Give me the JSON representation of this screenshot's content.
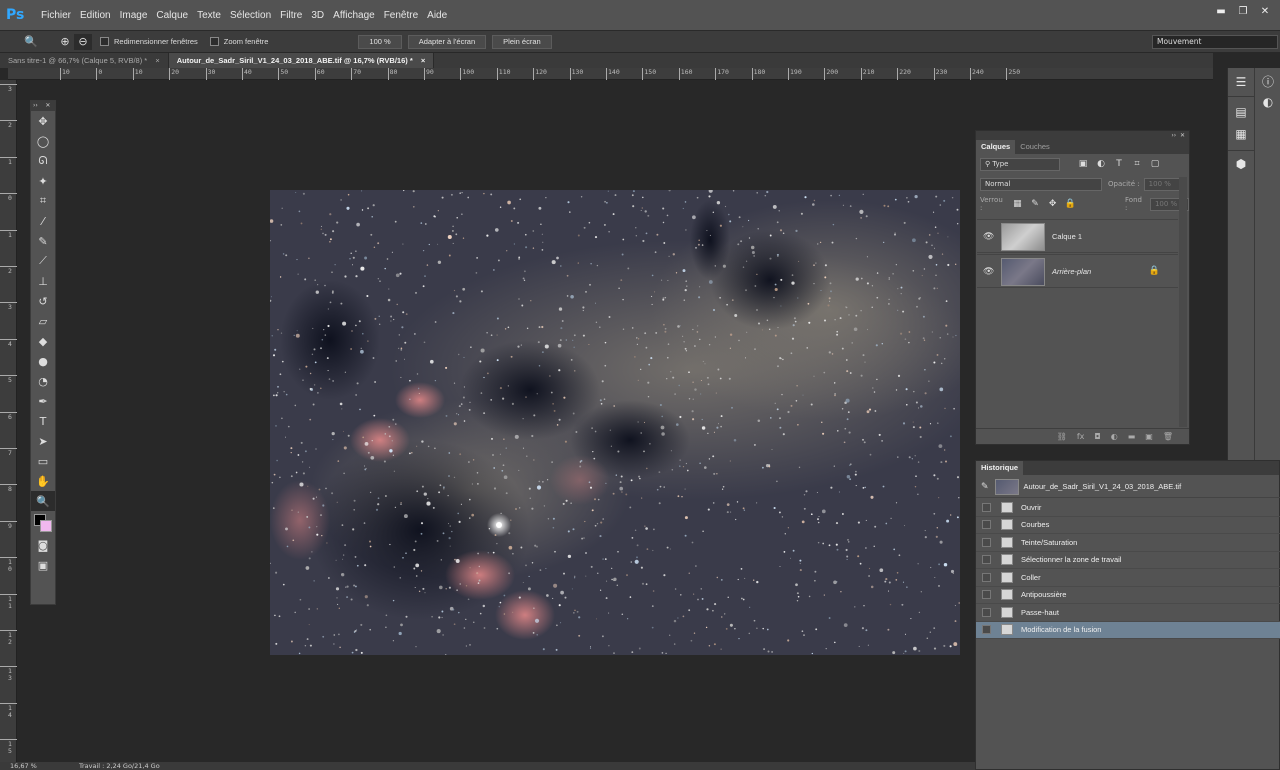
{
  "app": {
    "logo": "Ps"
  },
  "menu": [
    "Fichier",
    "Edition",
    "Image",
    "Calque",
    "Texte",
    "Sélection",
    "Filtre",
    "3D",
    "Affichage",
    "Fenêtre",
    "Aide"
  ],
  "window_controls": {
    "minimize": "▬",
    "restore": "❐",
    "close": "✕"
  },
  "options": {
    "resize_windows": "Redimensionner fenêtres",
    "zoom_windows": "Zoom fenêtre",
    "zoom_level": "100 %",
    "fit_screen": "Adapter à l'écran",
    "full_screen": "Plein écran",
    "workspace": "Mouvement"
  },
  "tabs": [
    {
      "label": "Sans titre-1 @ 66,7% (Calque 5, RVB/8) *",
      "close": "×"
    },
    {
      "label": "Autour_de_Sadr_Siril_V1_24_03_2018_ABE.tif @ 16,7% (RVB/16) *",
      "close": "×"
    }
  ],
  "ruler_h": [
    "10",
    "0",
    "10",
    "20",
    "30",
    "40",
    "50",
    "60",
    "70",
    "80",
    "90",
    "100",
    "110",
    "120",
    "130",
    "140",
    "150",
    "160",
    "170",
    "180",
    "190",
    "200",
    "210",
    "220",
    "230",
    "240",
    "250"
  ],
  "ruler_v": [
    "3",
    "2",
    "1",
    "0",
    "1",
    "2",
    "3",
    "4",
    "5",
    "6",
    "7",
    "8",
    "9",
    "10",
    "11",
    "12",
    "13",
    "14",
    "15"
  ],
  "layers_panel": {
    "tab_layers": "Calques",
    "tab_channels": "Couches",
    "filter_label": "Type",
    "blend_mode": "Normal",
    "opacity_label": "Opacité :",
    "opacity_value": "100 %",
    "lock_label": "Verrou :",
    "fill_label": "Fond :",
    "fill_value": "100 %",
    "layers": [
      {
        "name": "Calque 1",
        "visible": true,
        "locked": false
      },
      {
        "name": "Arrière-plan",
        "visible": true,
        "locked": true
      }
    ]
  },
  "history_panel": {
    "tab": "Historique",
    "snapshot": "Autour_de_Sadr_Siril_V1_24_03_2018_ABE.tif",
    "steps": [
      "Ouvrir",
      "Courbes",
      "Teinte/Saturation",
      "Sélectionner la zone de travail",
      "Coller",
      "Antipoussière",
      "Passe-haut",
      "Modification de la fusion"
    ],
    "selected_index": 7
  },
  "status": {
    "zoom": "16,67 %",
    "info": "Travail : 2,24 Go/21,4 Go"
  },
  "colors": {
    "foreground": "#000000",
    "background": "#f0b8ee",
    "history_selected": "#6e8294"
  },
  "tools": [
    "move-icon",
    "marquee-icon",
    "lasso-icon",
    "magic-wand-icon",
    "crop-icon",
    "eyedropper-icon",
    "healing-icon",
    "brush-icon",
    "stamp-icon",
    "history-brush-icon",
    "eraser-icon",
    "bucket-icon",
    "blur-icon",
    "dodge-icon",
    "pen-icon",
    "text-icon",
    "path-select-icon",
    "shape-icon",
    "hand-icon",
    "zoom-icon"
  ]
}
